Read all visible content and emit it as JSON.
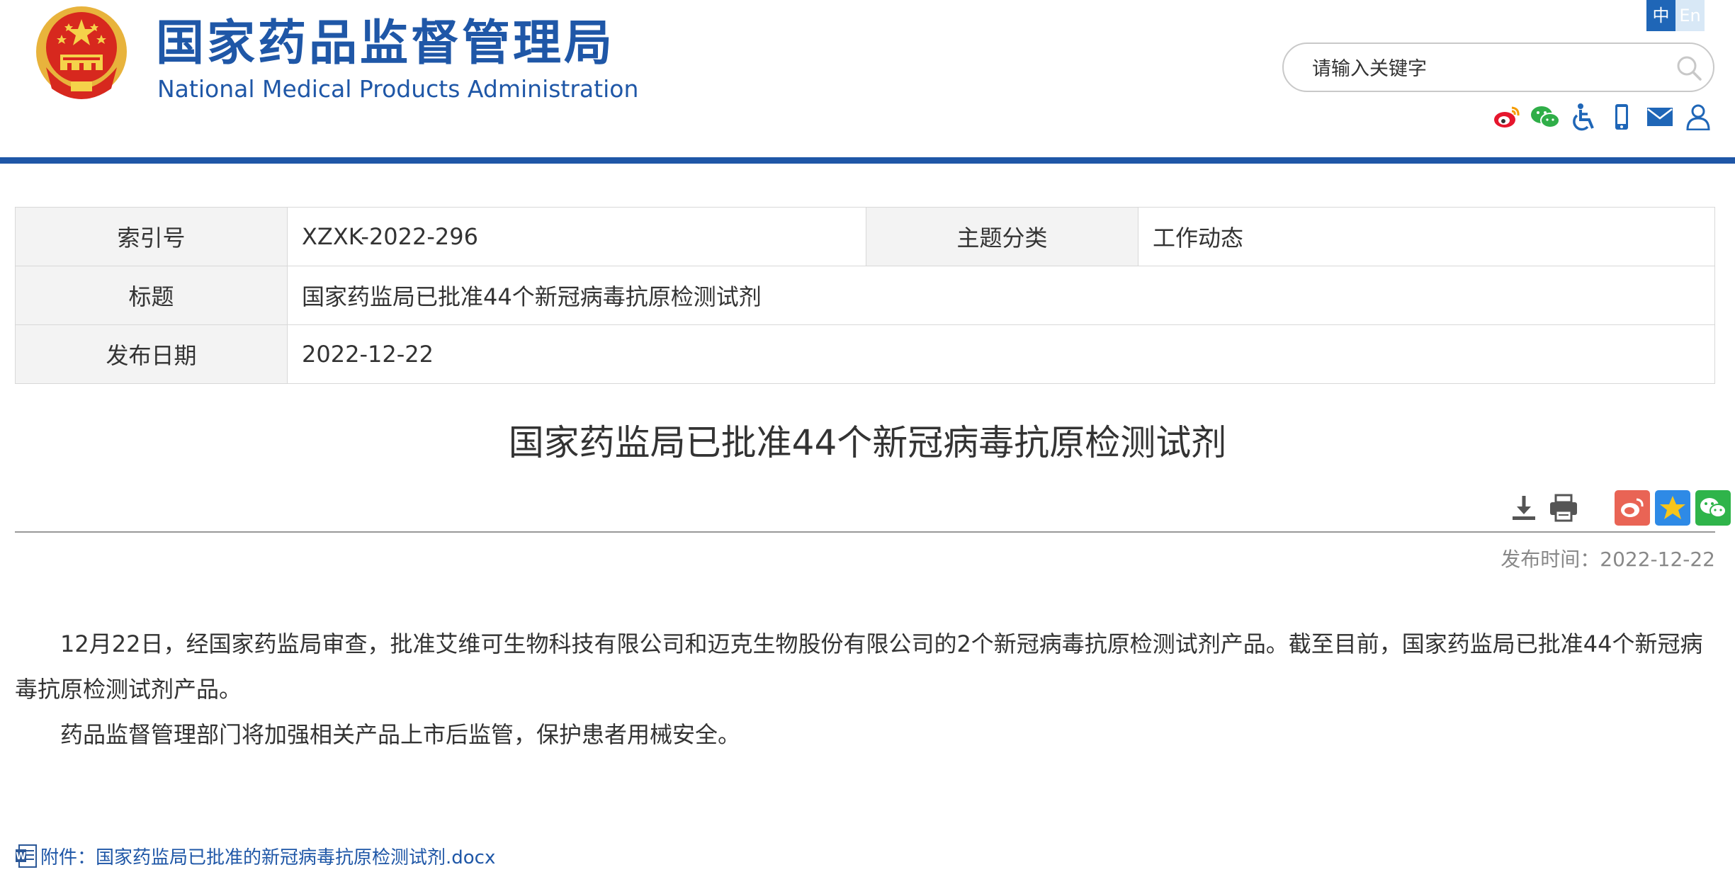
{
  "header": {
    "title_cn": "国家药品监督管理局",
    "title_en": "National Medical Products Administration",
    "lang_zh": "中",
    "lang_en": "En",
    "search_placeholder": "请输入关键字",
    "utility_icons": [
      "weibo-icon",
      "wechat-icon",
      "accessibility-icon",
      "mobile-icon",
      "mail-icon",
      "user-icon"
    ],
    "brand_color": "#1f57a7"
  },
  "info": {
    "index_label": "索引号",
    "index_value": "XZXK-2022-296",
    "topic_label": "主题分类",
    "topic_value": "工作动态",
    "title_label": "标题",
    "title_value": "国家药监局已批准44个新冠病毒抗原检测试剂",
    "date_label": "发布日期",
    "date_value": "2022-12-22"
  },
  "article": {
    "title": "国家药监局已批准44个新冠病毒抗原检测试剂",
    "publish_time": "发布时间：2022-12-22",
    "paragraphs": [
      "12月22日，经国家药监局审查，批准艾维可生物科技有限公司和迈克生物股份有限公司的2个新冠病毒抗原检测试剂产品。截至目前，国家药监局已批准44个新冠病毒抗原检测试剂产品。",
      "药品监督管理部门将加强相关产品上市后监管，保护患者用械安全。"
    ],
    "attachment": "附件：国家药监局已批准的新冠病毒抗原检测试剂.docx"
  },
  "tools": [
    "download-icon",
    "print-icon",
    "share-weibo-icon",
    "share-qzone-icon",
    "share-wechat-icon"
  ]
}
